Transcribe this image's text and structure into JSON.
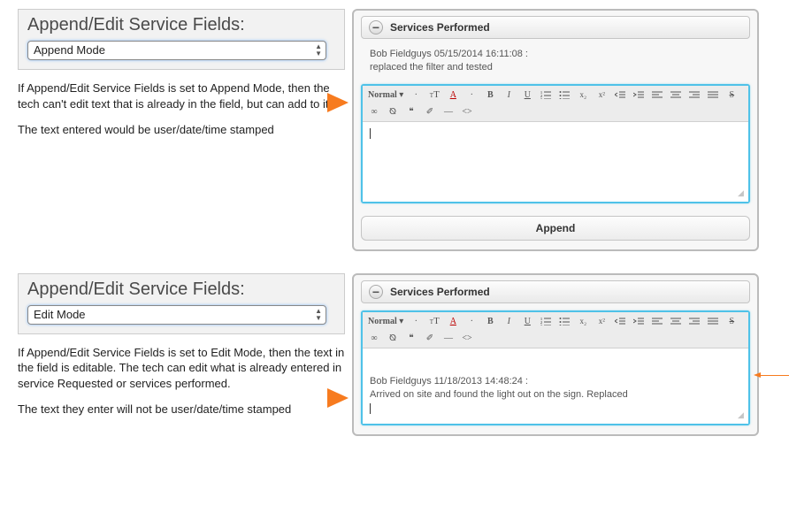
{
  "section1": {
    "heading": "Append/Edit Service Fields:",
    "select_value": "Append Mode",
    "desc1": "If Append/Edit Service Fields is set to Append Mode, then the tech can't edit text that is already in the field, but can add to it.",
    "desc2": "The text entered would be user/date/time stamped",
    "panel_title": "Services Performed",
    "record_line1": "Bob Fieldguys 05/15/2014 16:11:08 :",
    "record_line2": "replaced the filter and tested",
    "append_button": "Append"
  },
  "section2": {
    "heading": "Append/Edit Service Fields:",
    "select_value": "Edit Mode",
    "desc1": "If Append/Edit Service Fields is set to Edit Mode, then the text in the field is editable. The tech can edit what is already entered in service Requested or services performed.",
    "desc2": "The text they enter will not be user/date/time stamped",
    "panel_title": "Services Performed",
    "record_line1": "Bob Fieldguys 11/18/2013 14:48:24 :",
    "record_line2": "Arrived on site and found the light out on the sign. Replaced"
  },
  "toolbar": {
    "normal": "Normal",
    "fontsize_small": "T",
    "fontsize_big": "T",
    "textcolor": "A",
    "bold": "B",
    "italic": "I",
    "underline": "U",
    "sub": "x₂",
    "sup": "x²",
    "strike": "S",
    "link": "∞",
    "unlink": "⦰",
    "quote": "❝",
    "eraser": "✐",
    "hr": "—",
    "code": "<>"
  }
}
